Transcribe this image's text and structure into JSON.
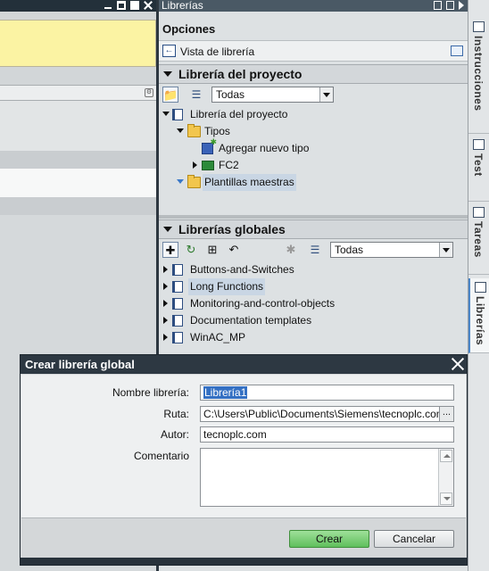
{
  "panel": {
    "title": "Librerías",
    "options_header": "Opciones",
    "library_view_label": "Vista de librería"
  },
  "project_library": {
    "header": "Librería del proyecto",
    "filter_value": "Todas",
    "tree": {
      "root": "Librería del proyecto",
      "types_folder": "Tipos",
      "add_new_type": "Agregar nuevo tipo",
      "fc2": "FC2",
      "master_copies": "Plantillas maestras"
    }
  },
  "global_libraries": {
    "header": "Librerías globales",
    "filter_value": "Todas",
    "items": [
      {
        "label": "Buttons-and-Switches"
      },
      {
        "label": "Long Functions"
      },
      {
        "label": "Monitoring-and-control-objects"
      },
      {
        "label": "Documentation templates"
      },
      {
        "label": "WinAC_MP"
      }
    ]
  },
  "vertical_tabs": [
    {
      "label": "Instrucciones"
    },
    {
      "label": "Test"
    },
    {
      "label": "Tareas"
    },
    {
      "label": "Librerías"
    }
  ],
  "dialog": {
    "title": "Crear librería global",
    "name_label": "Nombre librería:",
    "name_value": "Librería1",
    "path_label": "Ruta:",
    "path_value": "C:\\Users\\Public\\Documents\\Siemens\\tecnoplc.com",
    "browse_label": "...",
    "author_label": "Autor:",
    "author_value": "tecnoplc.com",
    "comment_label": "Comentario",
    "create_button": "Crear",
    "cancel_button": "Cancelar"
  }
}
